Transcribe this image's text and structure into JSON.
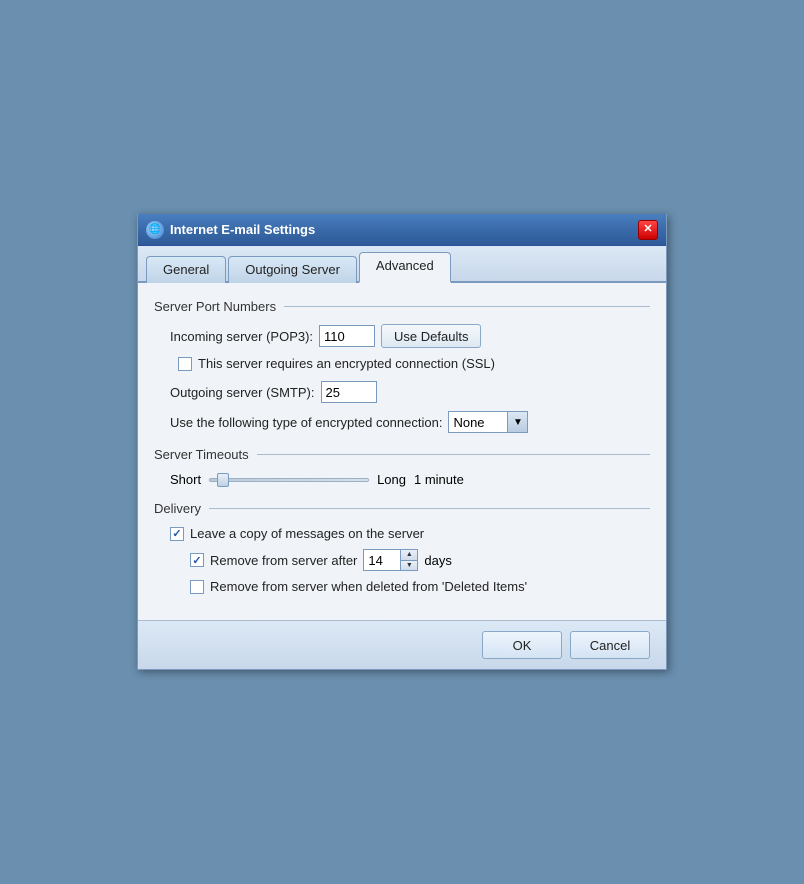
{
  "dialog": {
    "title": "Internet E-mail Settings",
    "close_label": "✕"
  },
  "tabs": [
    {
      "id": "general",
      "label": "General",
      "active": false
    },
    {
      "id": "outgoing-server",
      "label": "Outgoing Server",
      "active": false
    },
    {
      "id": "advanced",
      "label": "Advanced",
      "active": true
    }
  ],
  "sections": {
    "server_ports": {
      "header": "Server Port Numbers",
      "incoming_label": "Incoming server (POP3):",
      "incoming_value": "110",
      "use_defaults_label": "Use Defaults",
      "ssl_checkbox_label": "This server requires an encrypted connection (SSL)",
      "ssl_checked": false,
      "outgoing_label": "Outgoing server (SMTP):",
      "outgoing_value": "25",
      "encrypt_label": "Use the following type of encrypted connection:",
      "encrypt_value": "None"
    },
    "server_timeouts": {
      "header": "Server Timeouts",
      "short_label": "Short",
      "long_label": "Long",
      "timeout_value": "1 minute"
    },
    "delivery": {
      "header": "Delivery",
      "leave_copy_label": "Leave a copy of messages on the server",
      "leave_copy_checked": true,
      "remove_after_label": "Remove from server after",
      "remove_after_checked": true,
      "remove_days": "14",
      "days_label": "days",
      "remove_deleted_label": "Remove from server when deleted from 'Deleted Items'",
      "remove_deleted_checked": false
    }
  },
  "footer": {
    "ok_label": "OK",
    "cancel_label": "Cancel"
  }
}
